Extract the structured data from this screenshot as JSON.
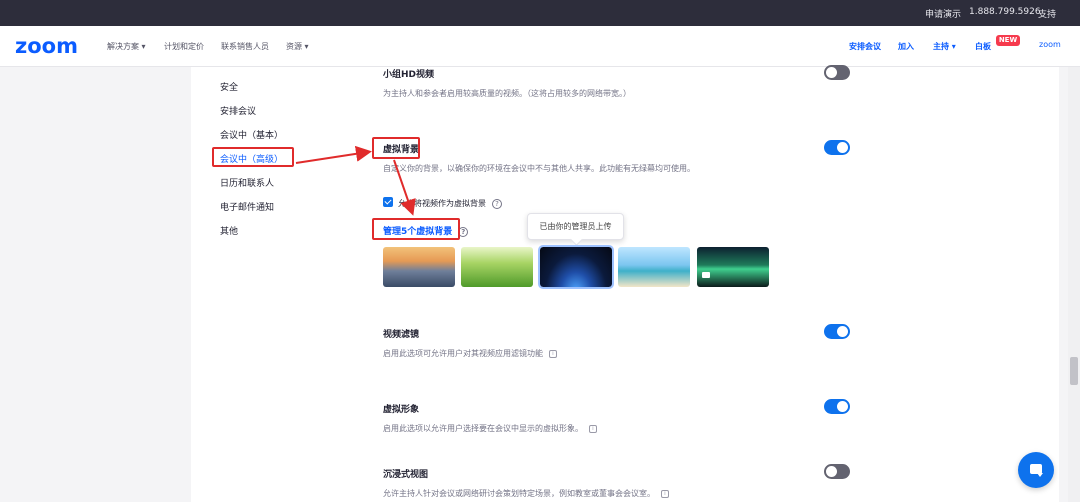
{
  "topbar": {
    "request_demo": "申请演示",
    "phone": "1.888.799.5926",
    "support": "支持"
  },
  "nav": {
    "logo": "zoom",
    "solutions": "解决方案 ▾",
    "plans": "计划和定价",
    "contact_sales": "联系销售人员",
    "resources": "资源 ▾",
    "schedule": "安排会议",
    "join": "加入",
    "host": "主持 ▾",
    "whiteboard": "白板",
    "new_badge": "NEW",
    "zoom_small": "zoom"
  },
  "sidebar": {
    "items": [
      {
        "label": "安全"
      },
      {
        "label": "安排会议"
      },
      {
        "label": "会议中（基本）"
      },
      {
        "label": "会议中（高级）"
      },
      {
        "label": "日历和联系人"
      },
      {
        "label": "电子邮件通知"
      },
      {
        "label": "其他"
      }
    ]
  },
  "settings": {
    "group_hd": {
      "title": "小组HD视频",
      "desc": "为主持人和参会者启用较高质量的视频。（这将占用较多的网络带宽。）",
      "enabled": false
    },
    "virtual_bg": {
      "title": "虚拟背景",
      "desc": "自定义你的背景，以确保你的环境在会议中不与其他人共享。此功能有无绿幕均可使用。",
      "enabled": true,
      "allow_video_label": "允许将视频作为虚拟背景",
      "allow_video_checked": true,
      "manage_link": "管理5个虚拟背景",
      "tooltip": "已由你的管理员上传",
      "backgrounds": [
        "golden-gate-bridge",
        "grass",
        "earth-from-space",
        "beach-palm",
        "aurora-video"
      ]
    },
    "video_filters": {
      "title": "视频滤镜",
      "desc": "启用此选项可允许用户对其视频应用滤镜功能",
      "enabled": true
    },
    "avatars": {
      "title": "虚拟形象",
      "desc": "启用此选项以允许用户选择要在会议中显示的虚拟形象。",
      "enabled": true
    },
    "immersive": {
      "title": "沉浸式视图",
      "desc": "允许主持人针对会议或网络研讨会策划特定场景，例如教室或董事会会议室。",
      "enabled": false
    }
  },
  "colors": {
    "brand": "#0b5cff",
    "toggle_on": "#0e72ed",
    "annotation": "#e02b2b"
  }
}
